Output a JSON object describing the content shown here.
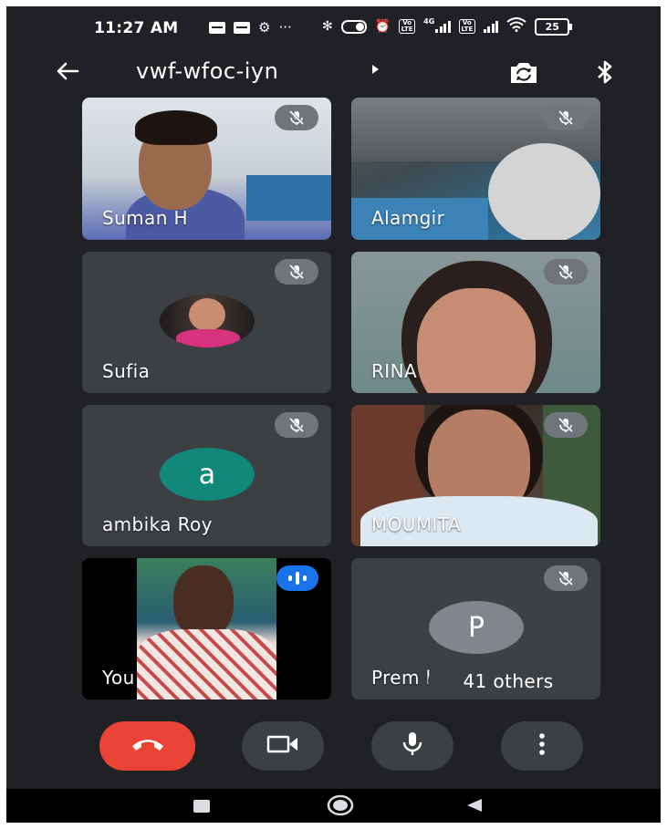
{
  "status_bar": {
    "time": "11:27 AM",
    "network": "4G",
    "battery": "25"
  },
  "top_bar": {
    "meeting_code": "vwf-wfoc-iyn"
  },
  "participants": [
    {
      "name": "Suman H",
      "muted": true
    },
    {
      "name": "Alamgir",
      "muted": true
    },
    {
      "name": "Sufia",
      "muted": true
    },
    {
      "name": "RINA",
      "muted": true
    },
    {
      "name": "ambika Roy",
      "muted": true,
      "avatar_letter": "a",
      "avatar_color": "#12887a"
    },
    {
      "name": "MOUMITA",
      "muted": true
    },
    {
      "name": "You",
      "muted": false,
      "speaking": true
    },
    {
      "name": "Prem kumar",
      "muted": true,
      "avatar_letter": "P",
      "avatar_color": "#80868b"
    }
  ],
  "others_chip": "41 others",
  "colors": {
    "background": "#202124",
    "tile": "#3c4043",
    "end_call": "#ea4335",
    "speaking": "#1a73e8"
  },
  "controls": {
    "end_call": "phone-hangup-icon",
    "camera": "video-camera-icon",
    "mic": "microphone-icon",
    "more": "more-vert-icon"
  }
}
